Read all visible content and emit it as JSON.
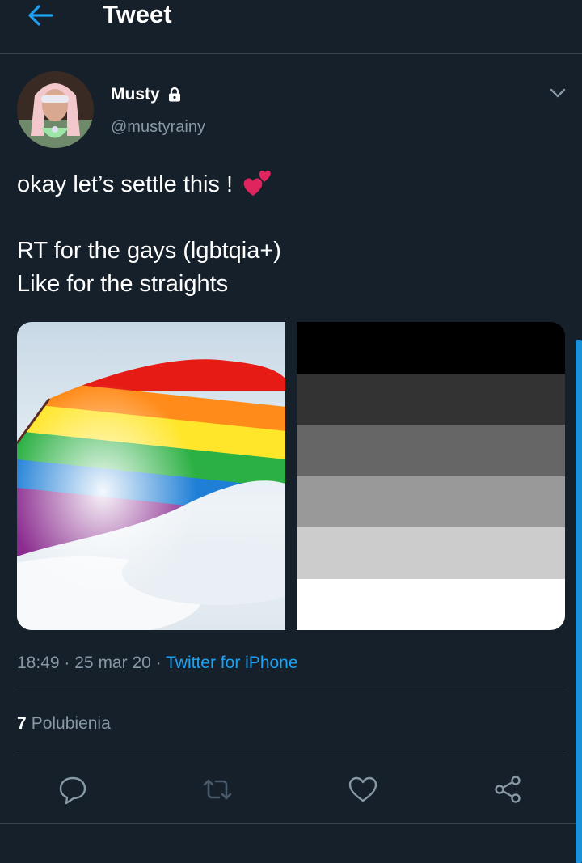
{
  "header": {
    "title": "Tweet"
  },
  "author": {
    "display_name": "Musty",
    "handle": "@mustyrainy"
  },
  "tweet": {
    "line1": "okay let’s settle this !",
    "line2": "RT for the gays (lgbtqia+)",
    "line3": "Like for the straights"
  },
  "meta": {
    "time": "18:49",
    "date": "25 mar 20",
    "separator": "·",
    "source": "Twitter for iPhone"
  },
  "likes": {
    "count": "7",
    "label": "Polubienia"
  },
  "colors": {
    "background": "#15202b",
    "accent": "#1da1f2",
    "secondary_text": "#8899a6",
    "divider": "#38444d"
  },
  "icons": [
    "back-arrow-icon",
    "lock-icon",
    "chevron-down-icon",
    "two-hearts-emoji",
    "reply-icon",
    "retweet-icon",
    "like-icon",
    "share-icon"
  ]
}
